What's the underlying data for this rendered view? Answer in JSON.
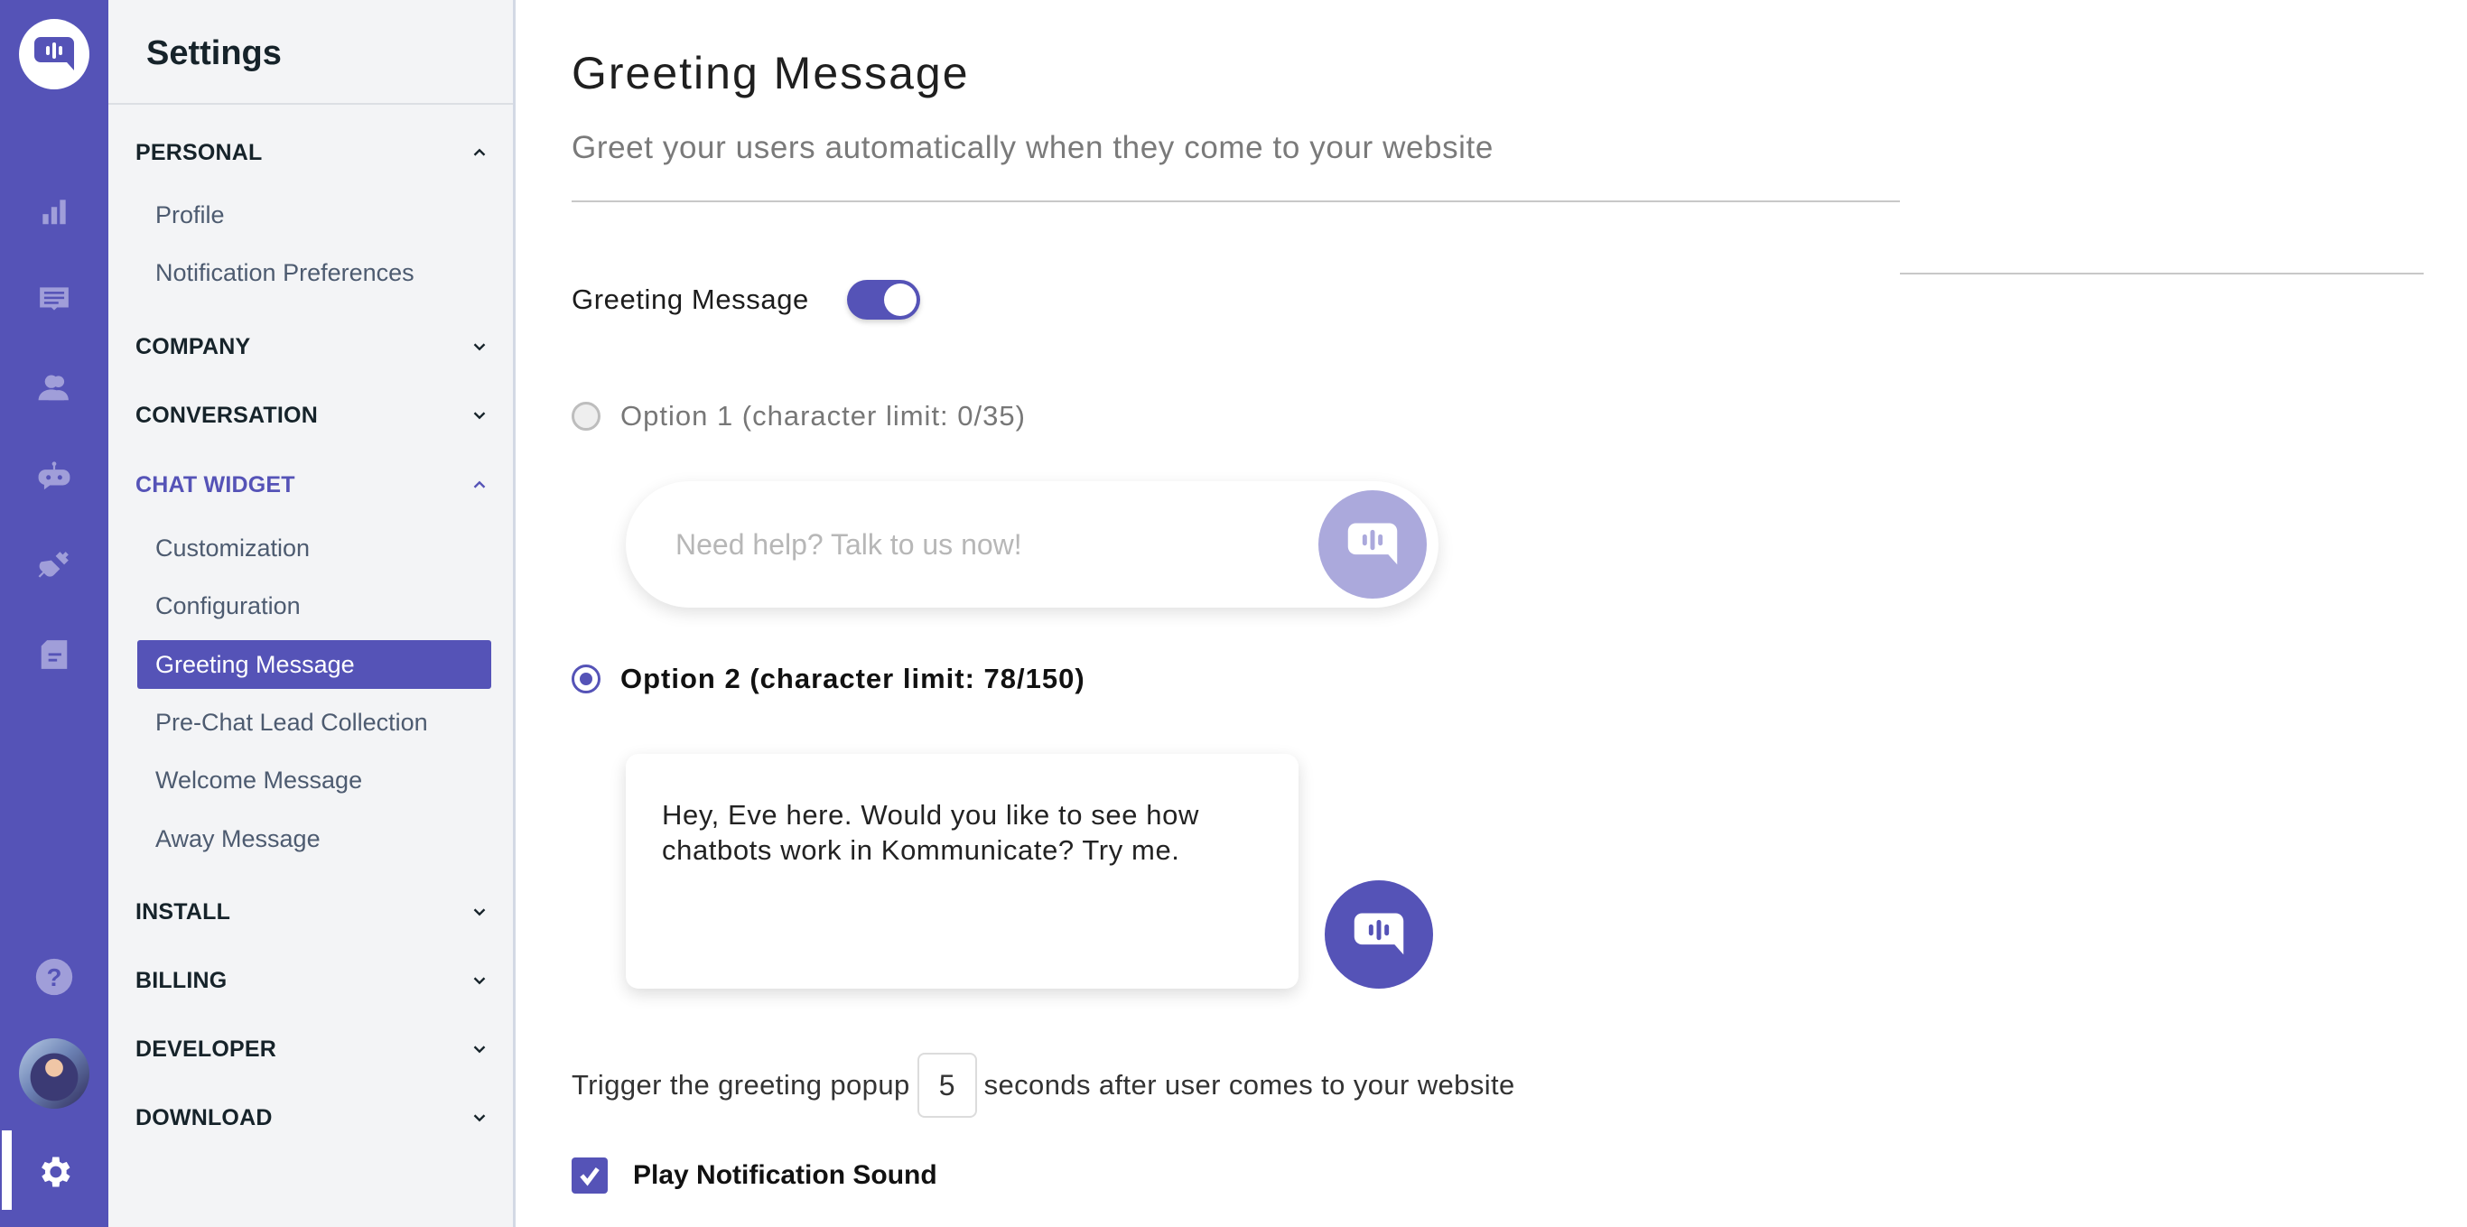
{
  "theme": {
    "accent": "#5553b7",
    "accent_light": "#aba9dc",
    "rail_icon": "#a09ed9"
  },
  "rail": {
    "logo": "kommunicate-logo-icon",
    "items": [
      {
        "name": "reports",
        "icon": "bar-chart-icon"
      },
      {
        "name": "conversations",
        "icon": "chat-message-icon"
      },
      {
        "name": "users",
        "icon": "users-icon"
      },
      {
        "name": "bots",
        "icon": "bot-icon"
      },
      {
        "name": "integrations",
        "icon": "plug-icon"
      },
      {
        "name": "knowledge-base",
        "icon": "document-icon"
      }
    ],
    "help": "help-icon",
    "avatar": "user-avatar",
    "settings": "gear-icon"
  },
  "sidebar": {
    "title": "Settings",
    "sections": [
      {
        "label": "PERSONAL",
        "expanded": true,
        "items": [
          "Profile",
          "Notification Preferences"
        ]
      },
      {
        "label": "COMPANY",
        "expanded": false
      },
      {
        "label": "CONVERSATION",
        "expanded": false
      },
      {
        "label": "CHAT WIDGET",
        "expanded": true,
        "active": true,
        "items": [
          "Customization",
          "Configuration",
          "Greeting Message",
          "Pre-Chat Lead Collection",
          "Welcome Message",
          "Away Message"
        ],
        "selected": "Greeting Message"
      },
      {
        "label": "INSTALL",
        "expanded": false
      },
      {
        "label": "BILLING",
        "expanded": false
      },
      {
        "label": "DEVELOPER",
        "expanded": false
      },
      {
        "label": "DOWNLOAD",
        "expanded": false
      }
    ]
  },
  "main": {
    "title": "Greeting Message",
    "subtitle": "Greet your users automatically when they come to your website",
    "toggle": {
      "label": "Greeting Message",
      "on": true
    },
    "option1": {
      "label": "Option 1 (character limit: 0/35)",
      "selected": false,
      "placeholder": "Need help? Talk to us now!",
      "value": ""
    },
    "option2": {
      "label": "Option 2 (character limit: 78/150)",
      "selected": true,
      "value": "Hey, Eve here. Would you like to see how chatbots work in Kommunicate? Try me."
    },
    "trigger": {
      "prefix": "Trigger the greeting popup",
      "seconds": "5",
      "suffix": "seconds after user comes to your website"
    },
    "notification_sound": {
      "label": "Play Notification Sound",
      "checked": true
    }
  }
}
